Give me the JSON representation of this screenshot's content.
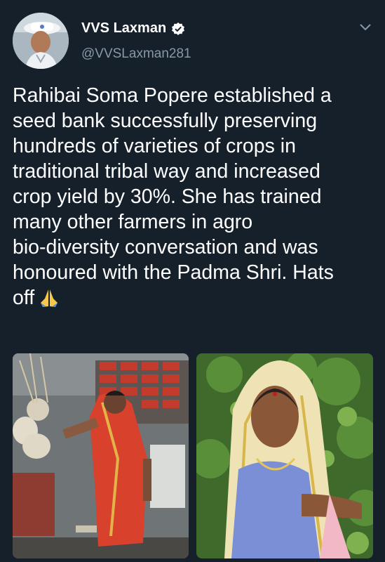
{
  "author": {
    "name": "VVS Laxman",
    "handle": "@VVSLaxman281",
    "avatar_icon": "profile-photo",
    "verified_icon": "verified-badge-icon",
    "verified_color": "#ffffff"
  },
  "menu_icon": "chevron-down-icon",
  "tweet": {
    "text": "Rahibai Soma Popere established a\nseed bank successfully preserving\nhundreds of varieties of crops in\ntraditional tribal way and increased\ncrop yield by 30%. She has trained\nmany other farmers in agro\nbio-diversity conversation and was\nhonoured with the Padma Shri. Hats\noff",
    "emoji_icon": "folded-hands-emoji"
  },
  "media": [
    {
      "icon": "photo-woman-in-seed-bank"
    },
    {
      "icon": "photo-woman-in-field"
    }
  ],
  "colors": {
    "background": "#15202b",
    "text": "#ffffff",
    "secondary": "#8899a6"
  }
}
